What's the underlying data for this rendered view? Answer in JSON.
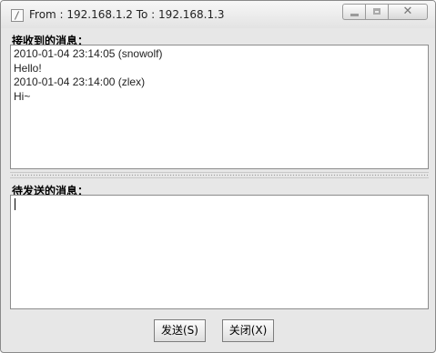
{
  "window": {
    "title": "From : 192.168.1.2 To : 192.168.1.3",
    "close_glyph": "✕"
  },
  "received": {
    "label": "接收到的消息：",
    "messages": [
      "2010-01-04 23:14:05 (snowolf)",
      "Hello!",
      "2010-01-04 23:14:00 (zlex)",
      "Hi~"
    ]
  },
  "compose": {
    "label": "待发送的消息：",
    "value": ""
  },
  "buttons": {
    "send": "发送(S)",
    "close": "关闭(X)"
  },
  "icons": {
    "app": "java-cup-icon",
    "minimize": "minimize-icon",
    "maximize": "maximize-icon",
    "close": "close-icon"
  }
}
